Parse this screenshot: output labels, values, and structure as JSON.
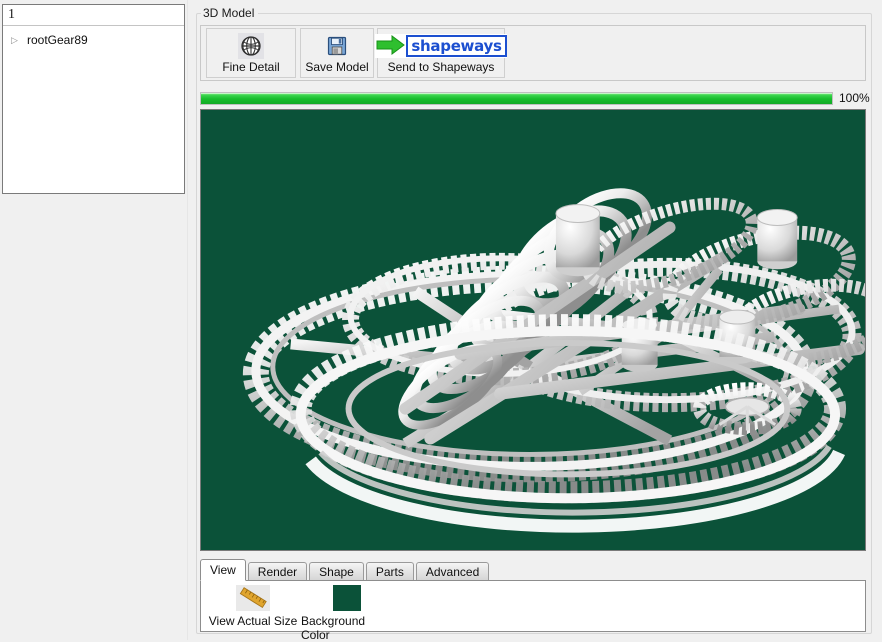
{
  "tree_panel": {
    "column_header": "1",
    "items": [
      {
        "label": "rootGear89",
        "expander": "▷",
        "expander_icon": "triangle-right-icon"
      }
    ]
  },
  "model_group": {
    "title": "3D Model",
    "toolbar": {
      "buttons": [
        {
          "label": "Fine Detail",
          "icon": "globe-icon"
        },
        {
          "label": "Save Model",
          "icon": "floppy-disk-save-icon"
        },
        {
          "label": "Send to Shapeways",
          "icon": "shapeways-logo-icon",
          "logo_word": "shapeways",
          "logo_arrow": "green-right-arrow-icon"
        }
      ]
    },
    "progress": {
      "percent": 100,
      "percent_label": "100%",
      "fill_color": "#17bd2c"
    },
    "viewport": {
      "background_color": "#0b5239",
      "model_color": "#e8e8e8",
      "content": "3d-gear-train-model"
    },
    "tabs": {
      "items": [
        {
          "label": "View",
          "selected": true
        },
        {
          "label": "Render",
          "selected": false
        },
        {
          "label": "Shape",
          "selected": false
        },
        {
          "label": "Parts",
          "selected": false
        },
        {
          "label": "Advanced",
          "selected": false
        }
      ],
      "view_tab_tools": [
        {
          "label": "View Actual Size",
          "icon": "ruler-icon"
        },
        {
          "label": "Background Color",
          "icon": "color-swatch-icon",
          "swatch_color": "#0b5239"
        }
      ]
    }
  }
}
